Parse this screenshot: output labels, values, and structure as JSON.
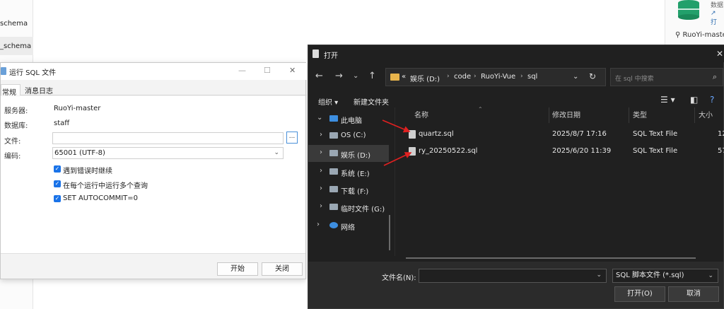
{
  "background": {
    "left_items": [
      "schema",
      "_schema"
    ],
    "right_db_text": "数据",
    "right_link_text": "↗ 打",
    "right_item": "RuoYi-master"
  },
  "run_sql": {
    "title": "运行 SQL 文件",
    "tabs": [
      "常规",
      "消息日志"
    ],
    "server_label": "服务器:",
    "server_value": "RuoYi-master",
    "database_label": "数据库:",
    "database_value": "staff",
    "file_label": "文件:",
    "file_value": "",
    "browse_label": "...",
    "encoding_label": "编码:",
    "encoding_value": "65001 (UTF-8)",
    "options": [
      {
        "label": "遇到错误时继续",
        "checked": true
      },
      {
        "label": "在每个运行中运行多个查询",
        "checked": true
      },
      {
        "label": "SET AUTOCOMMIT=0",
        "checked": true
      }
    ],
    "start_label": "开始",
    "close_label": "关闭"
  },
  "open_dialog": {
    "title": "打开",
    "breadcrumb": [
      "«",
      "娱乐 (D:)",
      "code",
      "RuoYi-Vue",
      "sql"
    ],
    "search_placeholder": "在 sql 中搜索",
    "organize_label": "组织 ▾",
    "new_folder_label": "新建文件夹",
    "tree": [
      {
        "label": "此电脑",
        "icon": "pc-icon",
        "expanded": true,
        "selected": false
      },
      {
        "label": "OS (C:)",
        "icon": "drive-icon",
        "expanded": false,
        "selected": false
      },
      {
        "label": "娱乐 (D:)",
        "icon": "drive-icon",
        "expanded": false,
        "selected": true
      },
      {
        "label": "系统 (E:)",
        "icon": "drive-icon",
        "expanded": false,
        "selected": false
      },
      {
        "label": "下载 (F:)",
        "icon": "drive-icon",
        "expanded": false,
        "selected": false
      },
      {
        "label": "临时文件 (G:)",
        "icon": "drive-icon",
        "expanded": false,
        "selected": false
      },
      {
        "label": "网络",
        "icon": "network-icon",
        "expanded": false,
        "selected": false
      }
    ],
    "columns": [
      "名称",
      "修改日期",
      "类型",
      "大小"
    ],
    "files": [
      {
        "name": "quartz.sql",
        "date": "2025/8/7 17:16",
        "type": "SQL Text File",
        "size": "12"
      },
      {
        "name": "ry_20250522.sql",
        "date": "2025/6/20 11:39",
        "type": "SQL Text File",
        "size": "57"
      }
    ],
    "filename_label": "文件名(N):",
    "filename_value": "",
    "filetype_value": "SQL 脚本文件 (*.sql)",
    "open_label": "打开(O)",
    "cancel_label": "取消",
    "annotation_color": "#e02020"
  }
}
